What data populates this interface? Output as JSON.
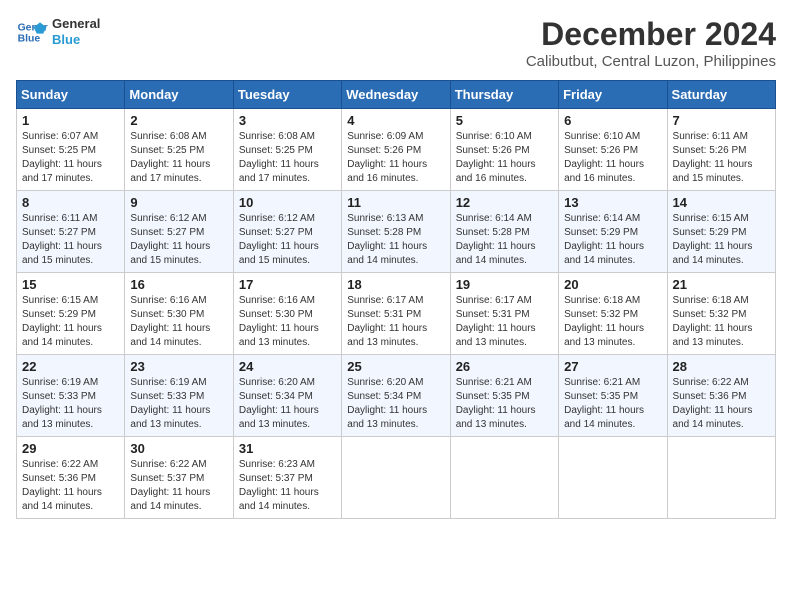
{
  "header": {
    "logo_line1": "General",
    "logo_line2": "Blue",
    "month_year": "December 2024",
    "location": "Calibutbut, Central Luzon, Philippines"
  },
  "days_of_week": [
    "Sunday",
    "Monday",
    "Tuesday",
    "Wednesday",
    "Thursday",
    "Friday",
    "Saturday"
  ],
  "weeks": [
    [
      {
        "day": "1",
        "sunrise": "6:07 AM",
        "sunset": "5:25 PM",
        "daylight": "11 hours and 17 minutes."
      },
      {
        "day": "2",
        "sunrise": "6:08 AM",
        "sunset": "5:25 PM",
        "daylight": "11 hours and 17 minutes."
      },
      {
        "day": "3",
        "sunrise": "6:08 AM",
        "sunset": "5:25 PM",
        "daylight": "11 hours and 17 minutes."
      },
      {
        "day": "4",
        "sunrise": "6:09 AM",
        "sunset": "5:26 PM",
        "daylight": "11 hours and 16 minutes."
      },
      {
        "day": "5",
        "sunrise": "6:10 AM",
        "sunset": "5:26 PM",
        "daylight": "11 hours and 16 minutes."
      },
      {
        "day": "6",
        "sunrise": "6:10 AM",
        "sunset": "5:26 PM",
        "daylight": "11 hours and 16 minutes."
      },
      {
        "day": "7",
        "sunrise": "6:11 AM",
        "sunset": "5:26 PM",
        "daylight": "11 hours and 15 minutes."
      }
    ],
    [
      {
        "day": "8",
        "sunrise": "6:11 AM",
        "sunset": "5:27 PM",
        "daylight": "11 hours and 15 minutes."
      },
      {
        "day": "9",
        "sunrise": "6:12 AM",
        "sunset": "5:27 PM",
        "daylight": "11 hours and 15 minutes."
      },
      {
        "day": "10",
        "sunrise": "6:12 AM",
        "sunset": "5:27 PM",
        "daylight": "11 hours and 15 minutes."
      },
      {
        "day": "11",
        "sunrise": "6:13 AM",
        "sunset": "5:28 PM",
        "daylight": "11 hours and 14 minutes."
      },
      {
        "day": "12",
        "sunrise": "6:14 AM",
        "sunset": "5:28 PM",
        "daylight": "11 hours and 14 minutes."
      },
      {
        "day": "13",
        "sunrise": "6:14 AM",
        "sunset": "5:29 PM",
        "daylight": "11 hours and 14 minutes."
      },
      {
        "day": "14",
        "sunrise": "6:15 AM",
        "sunset": "5:29 PM",
        "daylight": "11 hours and 14 minutes."
      }
    ],
    [
      {
        "day": "15",
        "sunrise": "6:15 AM",
        "sunset": "5:29 PM",
        "daylight": "11 hours and 14 minutes."
      },
      {
        "day": "16",
        "sunrise": "6:16 AM",
        "sunset": "5:30 PM",
        "daylight": "11 hours and 14 minutes."
      },
      {
        "day": "17",
        "sunrise": "6:16 AM",
        "sunset": "5:30 PM",
        "daylight": "11 hours and 13 minutes."
      },
      {
        "day": "18",
        "sunrise": "6:17 AM",
        "sunset": "5:31 PM",
        "daylight": "11 hours and 13 minutes."
      },
      {
        "day": "19",
        "sunrise": "6:17 AM",
        "sunset": "5:31 PM",
        "daylight": "11 hours and 13 minutes."
      },
      {
        "day": "20",
        "sunrise": "6:18 AM",
        "sunset": "5:32 PM",
        "daylight": "11 hours and 13 minutes."
      },
      {
        "day": "21",
        "sunrise": "6:18 AM",
        "sunset": "5:32 PM",
        "daylight": "11 hours and 13 minutes."
      }
    ],
    [
      {
        "day": "22",
        "sunrise": "6:19 AM",
        "sunset": "5:33 PM",
        "daylight": "11 hours and 13 minutes."
      },
      {
        "day": "23",
        "sunrise": "6:19 AM",
        "sunset": "5:33 PM",
        "daylight": "11 hours and 13 minutes."
      },
      {
        "day": "24",
        "sunrise": "6:20 AM",
        "sunset": "5:34 PM",
        "daylight": "11 hours and 13 minutes."
      },
      {
        "day": "25",
        "sunrise": "6:20 AM",
        "sunset": "5:34 PM",
        "daylight": "11 hours and 13 minutes."
      },
      {
        "day": "26",
        "sunrise": "6:21 AM",
        "sunset": "5:35 PM",
        "daylight": "11 hours and 13 minutes."
      },
      {
        "day": "27",
        "sunrise": "6:21 AM",
        "sunset": "5:35 PM",
        "daylight": "11 hours and 14 minutes."
      },
      {
        "day": "28",
        "sunrise": "6:22 AM",
        "sunset": "5:36 PM",
        "daylight": "11 hours and 14 minutes."
      }
    ],
    [
      {
        "day": "29",
        "sunrise": "6:22 AM",
        "sunset": "5:36 PM",
        "daylight": "11 hours and 14 minutes."
      },
      {
        "day": "30",
        "sunrise": "6:22 AM",
        "sunset": "5:37 PM",
        "daylight": "11 hours and 14 minutes."
      },
      {
        "day": "31",
        "sunrise": "6:23 AM",
        "sunset": "5:37 PM",
        "daylight": "11 hours and 14 minutes."
      },
      null,
      null,
      null,
      null
    ]
  ]
}
